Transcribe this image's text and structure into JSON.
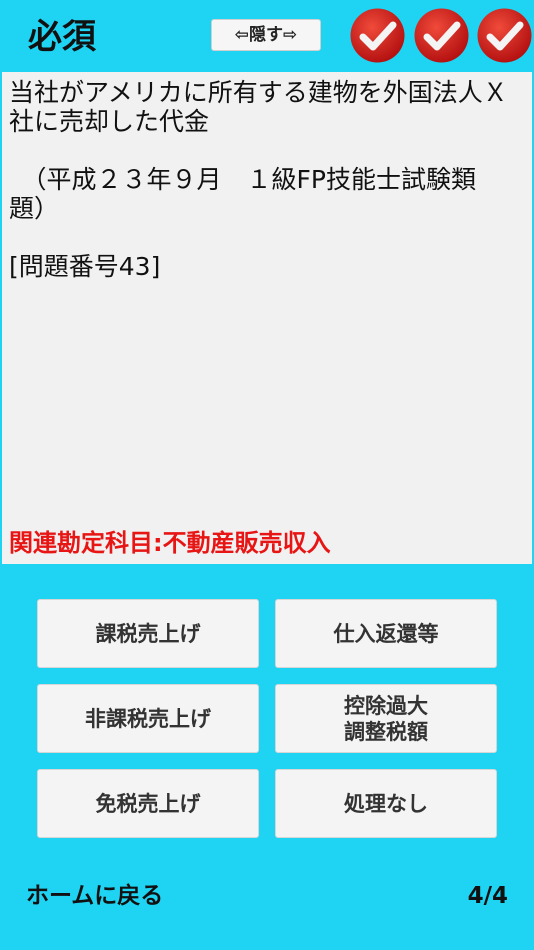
{
  "header": {
    "title": "必須",
    "hide_button_label": "⇦隠す⇨",
    "status_icons": [
      "checkmark-icon",
      "checkmark-icon",
      "checkmark-icon"
    ]
  },
  "question": {
    "text": "当社がアメリカに所有する建物を外国法人Ｘ社に売却した代金\n\n　（平成２３年９月　１級FP技能士試験類題）\n\n[問題番号43]",
    "related_label": "関連勘定科目:不動産販売収入"
  },
  "answers": [
    "課税売上げ",
    "仕入返還等",
    "非課税売上げ",
    "控除過大\n調整税額",
    "免税売上げ",
    "処理なし"
  ],
  "footer": {
    "home_label": "ホームに戻る",
    "page_indicator": "4/4"
  },
  "colors": {
    "background": "#1fd3f3",
    "check_red": "#d51e1e",
    "related_text": "#e81515"
  }
}
